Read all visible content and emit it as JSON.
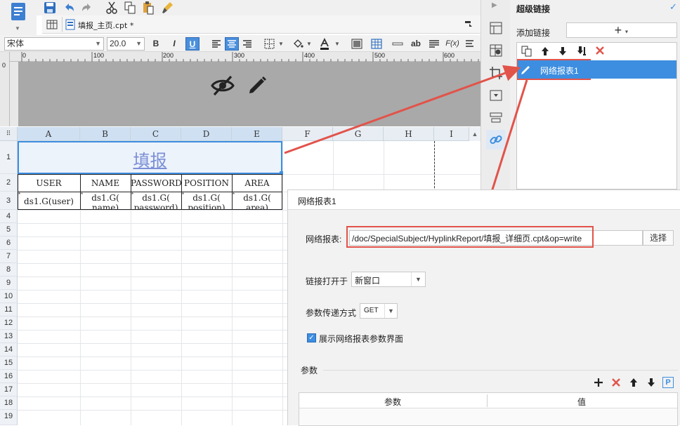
{
  "toolbar": {
    "icons": [
      "report-icon",
      "save-icon",
      "undo-icon",
      "redo-icon",
      "cut-icon",
      "copy-icon",
      "paste-icon",
      "format-painter-icon"
    ],
    "file_tab": "填报_主页.cpt *"
  },
  "format": {
    "font": "宋体",
    "size": "20.0",
    "bold": "B",
    "italic": "I",
    "underline": "U",
    "wrap_label": "ab",
    "formula_label": "F(x)"
  },
  "ruler": {
    "ticks": [
      "0",
      "100",
      "200",
      "300",
      "400",
      "500",
      "600"
    ]
  },
  "grid": {
    "columns": [
      "A",
      "B",
      "C",
      "D",
      "E",
      "F",
      "G",
      "H",
      "I"
    ],
    "rows": [
      "1",
      "2",
      "3",
      "4",
      "5",
      "6",
      "7",
      "8",
      "9",
      "10",
      "11",
      "12",
      "13",
      "14",
      "15",
      "16",
      "17",
      "18",
      "19"
    ],
    "title": "填报",
    "headers": [
      "USER",
      "NAME",
      "PASSWORD",
      "POSITION",
      "AREA"
    ],
    "row3": [
      {
        "line1": "ds1.G(user)",
        "line2": ""
      },
      {
        "line1": "ds1.G(",
        "line2": "name)"
      },
      {
        "line1": "ds1.G(",
        "line2": "password)"
      },
      {
        "line1": "ds1.G(",
        "line2": "position)"
      },
      {
        "line1": "ds1.G(",
        "line2": "area)"
      }
    ]
  },
  "hyperlink_panel": {
    "title": "超级链接",
    "add_label": "添加链接",
    "add_button": "+",
    "item": "网络报表1"
  },
  "dialog": {
    "title": "网络报表1",
    "report_label": "网络报表:",
    "report_path": "/doc/SpecialSubject/HyplinkReport/填报_详细页.cpt&op=write",
    "select_button": "选择",
    "open_in_label": "链接打开于",
    "open_in_value": "新窗口",
    "method_label": "参数传递方式",
    "method_value": "GET",
    "show_params_label": "展示网络报表参数界面",
    "params_label": "参数",
    "params_col_param": "参数",
    "params_col_value": "值"
  },
  "colors": {
    "accent": "#3d8ee0",
    "highlight": "#e2534a",
    "selected_item": "#3d8ee0"
  }
}
